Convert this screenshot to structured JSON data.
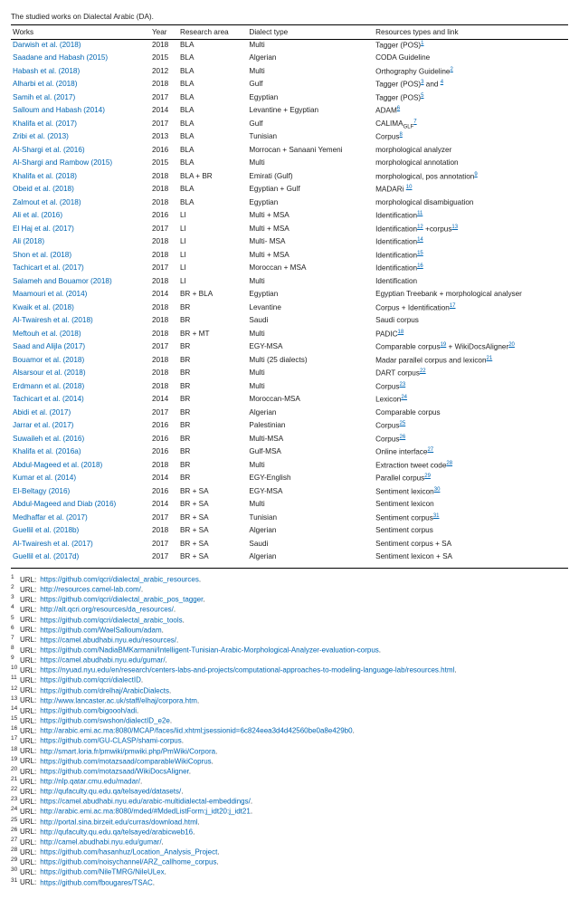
{
  "caption": "The studied works on Dialectal Arabic (DA).",
  "table": {
    "headers": [
      "Works",
      "Year",
      "Research area",
      "Dialect type",
      "Resources types and link"
    ],
    "rows": [
      {
        "work": "Darwish et al. (2018)",
        "year": "2018",
        "area": "BLA",
        "dialect": "Multi",
        "resources_parts": [
          {
            "t": "Tagger (POS)"
          },
          {
            "s": "1"
          }
        ]
      },
      {
        "work": "Saadane and Habash (2015)",
        "year": "2015",
        "area": "BLA",
        "dialect": "Algerian",
        "resources_parts": [
          {
            "t": "CODA Guideline"
          }
        ]
      },
      {
        "work": "Habash et al. (2018)",
        "year": "2012",
        "area": "BLA",
        "dialect": "Multi",
        "resources_parts": [
          {
            "t": "Orthography Guideline"
          },
          {
            "s": "2"
          }
        ]
      },
      {
        "work": "Alharbi et al. (2018)",
        "year": "2018",
        "area": "BLA",
        "dialect": "Gulf",
        "resources_parts": [
          {
            "t": "Tagger (POS)"
          },
          {
            "s": "3"
          },
          {
            "t": " and "
          },
          {
            "s": "4"
          }
        ]
      },
      {
        "work": "Samih et al. (2017)",
        "year": "2017",
        "area": "BLA",
        "dialect": "Egyptian",
        "resources_parts": [
          {
            "t": "Tagger (POS)"
          },
          {
            "s": "5"
          }
        ]
      },
      {
        "work": "Salloum and Habash (2014)",
        "year": "2014",
        "area": "BLA",
        "dialect": "Levantine + Egyptian",
        "resources_parts": [
          {
            "t": "ADAM"
          },
          {
            "s": "6"
          }
        ]
      },
      {
        "work": "Khalifa et al. (2017)",
        "year": "2017",
        "area": "BLA",
        "dialect": "Gulf",
        "resources_parts": [
          {
            "calima": true
          }
        ]
      },
      {
        "work": "Zribi et al. (2013)",
        "year": "2013",
        "area": "BLA",
        "dialect": "Tunisian",
        "resources_parts": [
          {
            "t": "Corpus"
          },
          {
            "s": "8"
          }
        ]
      },
      {
        "work": "Al-Shargi et al. (2016)",
        "year": "2016",
        "area": "BLA",
        "dialect": "Morrocan + Sanaani Yemeni",
        "resources_parts": [
          {
            "t": "morphological analyzer"
          }
        ]
      },
      {
        "work": "Al-Shargi and Rambow (2015)",
        "year": "2015",
        "area": "BLA",
        "dialect": "Multi",
        "resources_parts": [
          {
            "t": "morphological annotation"
          }
        ]
      },
      {
        "work": "Khalifa et al. (2018)",
        "year": "2018",
        "area": "BLA + BR",
        "dialect": "Emirati (Gulf)",
        "resources_parts": [
          {
            "t": "morphological, pos annotation"
          },
          {
            "s": "9"
          }
        ]
      },
      {
        "work": "Obeid et al. (2018)",
        "year": "2018",
        "area": "BLA",
        "dialect": "Egyptian + Gulf",
        "resources_parts": [
          {
            "t": "MADARi "
          },
          {
            "s": "10"
          }
        ]
      },
      {
        "work": "Zalmout et al. (2018)",
        "year": "2018",
        "area": "BLA",
        "dialect": "Egyptian",
        "resources_parts": [
          {
            "t": "morphological disambiguation"
          }
        ]
      },
      {
        "work": "Ali et al. (2016)",
        "year": "2016",
        "area": "LI",
        "dialect": "Multi + MSA",
        "resources_parts": [
          {
            "t": "Identification"
          },
          {
            "s": "11"
          }
        ]
      },
      {
        "work": "El Haj et al. (2017)",
        "year": "2017",
        "area": "LI",
        "dialect": "Multi + MSA",
        "resources_parts": [
          {
            "t": "Identification"
          },
          {
            "s": "12"
          },
          {
            "t": " +corpus"
          },
          {
            "s": "13"
          }
        ]
      },
      {
        "work": "Ali (2018)",
        "year": "2018",
        "area": "LI",
        "dialect": "Multi- MSA",
        "resources_parts": [
          {
            "t": "Identification"
          },
          {
            "s": "14"
          }
        ]
      },
      {
        "work": "Shon et al. (2018)",
        "year": "2018",
        "area": "LI",
        "dialect": "Multi + MSA",
        "resources_parts": [
          {
            "t": "Identification"
          },
          {
            "s": "15"
          }
        ]
      },
      {
        "work": "Tachicart et al. (2017)",
        "year": "2017",
        "area": "LI",
        "dialect": "Moroccan + MSA",
        "resources_parts": [
          {
            "t": "Identification"
          },
          {
            "s": "16"
          }
        ]
      },
      {
        "work": "Salameh and Bouamor (2018)",
        "year": "2018",
        "area": "LI",
        "dialect": "Multi",
        "resources_parts": [
          {
            "t": "Identification"
          }
        ]
      },
      {
        "work": "Maamouri et al. (2014)",
        "year": "2014",
        "area": "BR + BLA",
        "dialect": "Egyptian",
        "resources_parts": [
          {
            "t": "Egyptian Treebank + morphological analyser"
          }
        ]
      },
      {
        "work": "Kwaik et al. (2018)",
        "year": "2018",
        "area": "BR",
        "dialect": "Levantine",
        "resources_parts": [
          {
            "t": "Corpus + Identification"
          },
          {
            "s": "17"
          }
        ]
      },
      {
        "work": "Al-Twairesh et al. (2018)",
        "year": "2018",
        "area": "BR",
        "dialect": "Saudi",
        "resources_parts": [
          {
            "t": "Saudi corpus"
          }
        ]
      },
      {
        "work": "Meftouh et al. (2018)",
        "year": "2018",
        "area": "BR + MT",
        "dialect": "Multi",
        "resources_parts": [
          {
            "t": "PADIC"
          },
          {
            "s": "18"
          }
        ]
      },
      {
        "work": "Saad and Alijla (2017)",
        "year": "2017",
        "area": "BR",
        "dialect": "EGY-MSA",
        "resources_parts": [
          {
            "t": "Comparable corpus"
          },
          {
            "s": "19"
          },
          {
            "t": " + WikiDocsAligner"
          },
          {
            "s": "20"
          }
        ]
      },
      {
        "work": "Bouamor et al. (2018)",
        "year": "2018",
        "area": "BR",
        "dialect": "Multi (25 dialects)",
        "resources_parts": [
          {
            "t": "Madar parallel corpus and lexicon"
          },
          {
            "s": "21"
          }
        ]
      },
      {
        "work": "Alsarsour et al. (2018)",
        "year": "2018",
        "area": "BR",
        "dialect": "Multi",
        "resources_parts": [
          {
            "t": "DART corpus"
          },
          {
            "s": "22"
          }
        ]
      },
      {
        "work": "Erdmann et al. (2018)",
        "year": "2018",
        "area": "BR",
        "dialect": "Multi",
        "resources_parts": [
          {
            "t": "Corpus"
          },
          {
            "s": "23"
          }
        ]
      },
      {
        "work": "Tachicart et al. (2014)",
        "year": "2014",
        "area": "BR",
        "dialect": "Moroccan-MSA",
        "resources_parts": [
          {
            "t": "Lexicon"
          },
          {
            "s": "24"
          }
        ]
      },
      {
        "work": "Abidi et al. (2017)",
        "year": "2017",
        "area": "BR",
        "dialect": "Algerian",
        "resources_parts": [
          {
            "t": "Comparable corpus"
          }
        ]
      },
      {
        "work": "Jarrar et al. (2017)",
        "year": "2016",
        "area": "BR",
        "dialect": "Palestinian",
        "resources_parts": [
          {
            "t": "Corpus"
          },
          {
            "s": "25"
          }
        ]
      },
      {
        "work": "Suwaileh et al. (2016)",
        "year": "2016",
        "area": "BR",
        "dialect": "Multi-MSA",
        "resources_parts": [
          {
            "t": "Corpus"
          },
          {
            "s": "26"
          }
        ]
      },
      {
        "work": "Khalifa et al. (2016a)",
        "year": "2016",
        "area": "BR",
        "dialect": "Gulf-MSA",
        "resources_parts": [
          {
            "t": "Online interface"
          },
          {
            "s": "27"
          }
        ]
      },
      {
        "work": "Abdul-Mageed et al. (2018)",
        "year": "2018",
        "area": "BR",
        "dialect": "Multi",
        "resources_parts": [
          {
            "t": "Extraction tweet code"
          },
          {
            "s": "28"
          }
        ]
      },
      {
        "work": "Kumar et al. (2014)",
        "year": "2014",
        "area": "BR",
        "dialect": "EGY-English",
        "resources_parts": [
          {
            "t": "Parallel corpus"
          },
          {
            "s": "29"
          }
        ]
      },
      {
        "work": "El-Beltagy (2016)",
        "year": "2016",
        "area": "BR + SA",
        "dialect": "EGY-MSA",
        "resources_parts": [
          {
            "t": "Sentiment lexicon"
          },
          {
            "s": "30"
          }
        ]
      },
      {
        "work": "Abdul-Mageed and Diab (2016)",
        "year": "2014",
        "area": "BR + SA",
        "dialect": "Multi",
        "resources_parts": [
          {
            "t": "Sentiment lexicon"
          }
        ]
      },
      {
        "work": "Medhaffar et al. (2017)",
        "year": "2017",
        "area": "BR + SA",
        "dialect": "Tunisian",
        "resources_parts": [
          {
            "t": "Sentiment corpus"
          },
          {
            "s": "31"
          }
        ]
      },
      {
        "work": "Guellil et al. (2018b)",
        "year": "2018",
        "area": "BR + SA",
        "dialect": "Algerian",
        "resources_parts": [
          {
            "t": "Sentiment corpus"
          }
        ]
      },
      {
        "work": "Al-Twairesh et al. (2017)",
        "year": "2017",
        "area": "BR + SA",
        "dialect": "Saudi",
        "resources_parts": [
          {
            "t": "Sentiment corpus + SA"
          }
        ]
      },
      {
        "work": "Guellil et al. (2017d)",
        "year": "2017",
        "area": "BR + SA",
        "dialect": "Algerian",
        "resources_parts": [
          {
            "t": "Sentiment lexicon + SA"
          }
        ]
      }
    ]
  },
  "footnotes": [
    {
      "n": "1",
      "url": "https://github.com/qcri/dialectal_arabic_resources"
    },
    {
      "n": "2",
      "url": "http://resources.camel-lab.com/"
    },
    {
      "n": "3",
      "url": "https://github.com/qcri/dialectal_arabic_pos_tagger"
    },
    {
      "n": "4",
      "url": "http://alt.qcri.org/resources/da_resources/"
    },
    {
      "n": "5",
      "url": "https://github.com/qcri/dialectal_arabic_tools"
    },
    {
      "n": "6",
      "url": "https://github.com/WaelSalloum/adam"
    },
    {
      "n": "7",
      "url": "https://camel.abudhabi.nyu.edu/resources/"
    },
    {
      "n": "8",
      "url": "https://github.com/NadiaBMKarmani/Intelligent-Tunisian-Arabic-Morphological-Analyzer-evaluation-corpus"
    },
    {
      "n": "9",
      "url": "https://camel.abudhabi.nyu.edu/gumar/"
    },
    {
      "n": "10",
      "url": "https://nyuad.nyu.edu/en/research/centers-labs-and-projects/computational-approaches-to-modeling-language-lab/resources.html"
    },
    {
      "n": "11",
      "url": "https://github.com/qcri/dialectID"
    },
    {
      "n": "12",
      "url": "https://github.com/drelhaj/ArabicDialects"
    },
    {
      "n": "13",
      "url": "http://www.lancaster.ac.uk/staff/elhaj/corpora.htm"
    },
    {
      "n": "14",
      "url": "https://github.com/bigoooh/adi"
    },
    {
      "n": "15",
      "url": "https://github.com/swshon/dialectID_e2e"
    },
    {
      "n": "16",
      "url": "http://arabic.emi.ac.ma:8080/MCAP/faces/lid.xhtml;jsessionid=6c824eea3d4d42560be0a8e429b0"
    },
    {
      "n": "17",
      "url": "https://github.com/GU-CLASP/shami-corpus"
    },
    {
      "n": "18",
      "url": "http://smart.loria.fr/pmwiki/pmwiki.php/PmWiki/Corpora"
    },
    {
      "n": "19",
      "url": "https://github.com/motazsaad/comparableWikiCoprus"
    },
    {
      "n": "20",
      "url": "https://github.com/motazsaad/WikiDocsAligner"
    },
    {
      "n": "21",
      "url": "http://nlp.qatar.cmu.edu/madar/"
    },
    {
      "n": "22",
      "url": "http://qufaculty.qu.edu.qa/telsayed/datasets/"
    },
    {
      "n": "23",
      "url": "https://camel.abudhabi.nyu.edu/arabic-multidialectal-embeddings/"
    },
    {
      "n": "24",
      "url": "http://arabic.emi.ac.ma:8080/mded/#MdedListForm:j_idt20:j_idt21"
    },
    {
      "n": "25",
      "url": "http://portal.sina.birzeit.edu/curras/download.html"
    },
    {
      "n": "26",
      "url": "http://qufaculty.qu.edu.qa/telsayed/arabicweb16"
    },
    {
      "n": "27",
      "url": "http://camel.abudhabi.nyu.edu/gumar/"
    },
    {
      "n": "28",
      "url": "https://github.com/hasanhuz/Location_Analysis_Project"
    },
    {
      "n": "29",
      "url": "https://github.com/noisychannel/ARZ_callhome_corpus"
    },
    {
      "n": "30",
      "url": "https://github.com/NileTMRG/NileULex"
    },
    {
      "n": "31",
      "url": "https://github.com/fbougares/TSAC"
    }
  ],
  "labels": {
    "url": "URL:"
  },
  "calima": {
    "text": "CALIMA",
    "sub": "GLF",
    "sup": "7"
  }
}
